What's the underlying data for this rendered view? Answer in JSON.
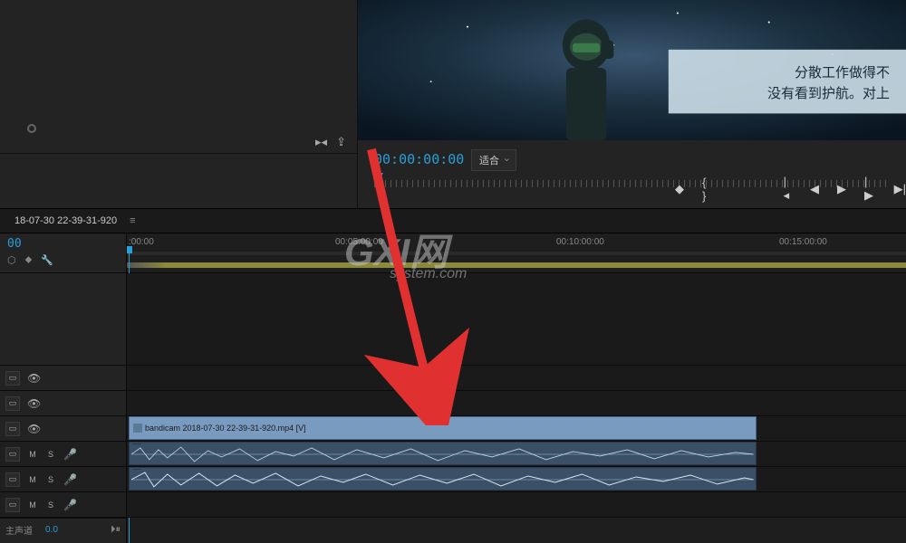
{
  "preview": {
    "subtitle_line1": "分散工作做得不",
    "subtitle_line2": "没有看到护航。对上"
  },
  "program": {
    "timecode": "00:00:00:00",
    "fit_label": "适合"
  },
  "sequence": {
    "tab_name": "18-07-30 22-39-31-920",
    "tl_timecode": "00"
  },
  "ruler": {
    "marks": [
      {
        "label": ":00:00",
        "pos": 2
      },
      {
        "label": "00:05:00:00",
        "pos": 230
      },
      {
        "label": "00:10:00:00",
        "pos": 474
      },
      {
        "label": "00:15:00:00",
        "pos": 720
      }
    ]
  },
  "clip": {
    "video_name": "bandicam 2018-07-30 22-39-31-920.mp4 [V]"
  },
  "tracks": {
    "audio": [
      {
        "m": "M",
        "s": "S"
      },
      {
        "m": "M",
        "s": "S"
      },
      {
        "m": "M",
        "s": "S"
      }
    ]
  },
  "master": {
    "label": "主声道",
    "value": "0.0"
  },
  "watermark": {
    "main": "GXI网",
    "sub": "system.com"
  }
}
